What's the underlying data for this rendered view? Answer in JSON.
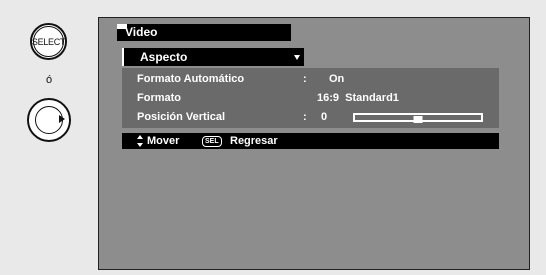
{
  "remote": {
    "select_label": "SELECT",
    "or_text": "ó"
  },
  "menu": {
    "title": "Video",
    "dropdown_label": "Aspecto",
    "rows": [
      {
        "label": "Formato Automático",
        "colon": ":",
        "value": "On"
      },
      {
        "label": "Formato",
        "colon": "",
        "value": "16:9  Standard1"
      },
      {
        "label": "Posición Vertical",
        "colon": ":",
        "value": "0"
      }
    ],
    "slider_level": 0.5
  },
  "help": {
    "move_label": "Mover",
    "sel_key": "SEL",
    "back_label": "Regresar"
  }
}
